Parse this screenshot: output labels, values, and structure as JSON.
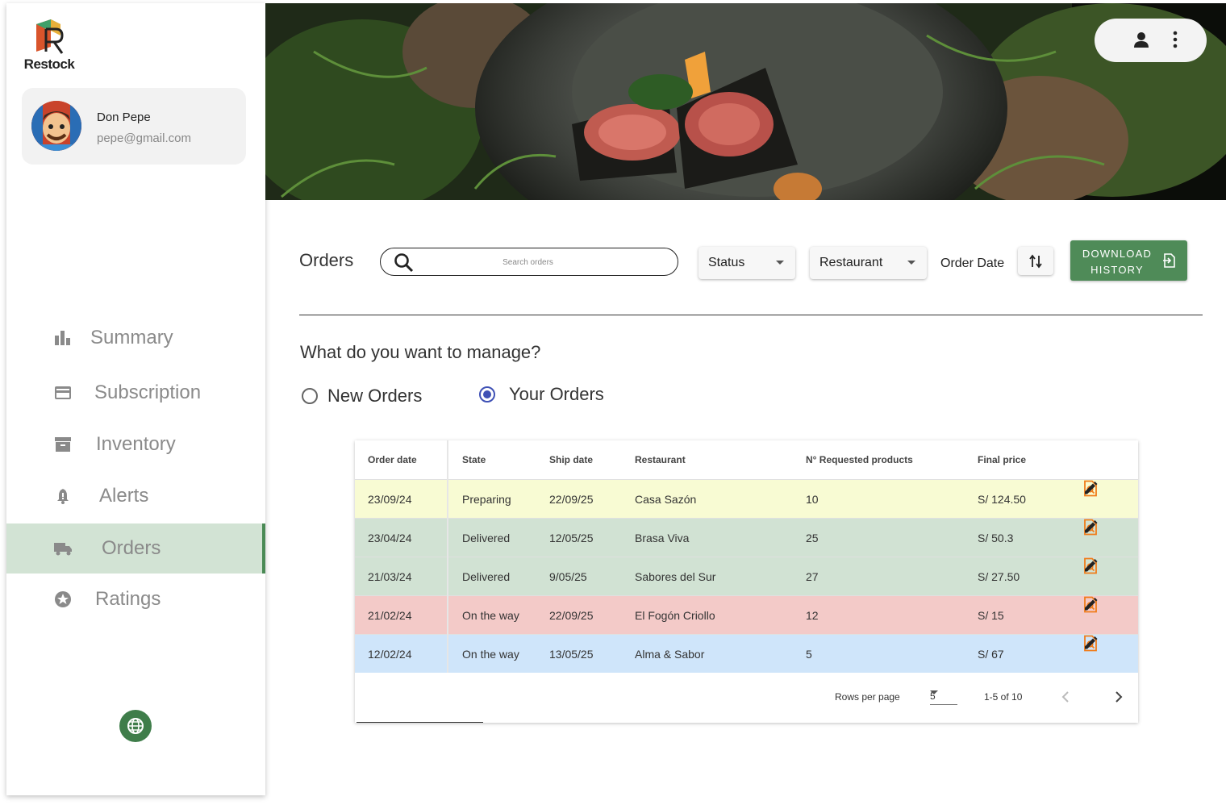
{
  "app": {
    "name": "Restock"
  },
  "profile": {
    "name": "Don Pepe",
    "email": "pepe@gmail.com"
  },
  "sidebar": {
    "items": [
      {
        "label": "Summary",
        "icon": "bar-chart-icon",
        "active": false
      },
      {
        "label": "Subscription",
        "icon": "credit-card-icon",
        "active": false
      },
      {
        "label": "Inventory",
        "icon": "archive-icon",
        "active": false
      },
      {
        "label": "Alerts",
        "icon": "bell-icon",
        "active": false
      },
      {
        "label": "Orders",
        "icon": "truck-icon",
        "active": true
      },
      {
        "label": "Ratings",
        "icon": "star-badge-icon",
        "active": false
      }
    ],
    "language_icon": "globe-icon"
  },
  "header": {
    "user_icon": "person-icon",
    "menu_icon": "more-vertical-icon"
  },
  "toolbar": {
    "title": "Orders",
    "search_placeholder": "Search orders",
    "status_label": "Status",
    "restaurant_label": "Restaurant",
    "order_date_label": "Order Date",
    "download_label": "DOWNLOAD HISTORY"
  },
  "manage": {
    "question": "What do you want to manage?",
    "options": [
      {
        "label": "New Orders",
        "selected": false
      },
      {
        "label": "Your Orders",
        "selected": true
      }
    ]
  },
  "table": {
    "columns": [
      "Order date",
      "State",
      "Ship date",
      "Restaurant",
      "N° Requested products",
      "Final price"
    ],
    "rows": [
      {
        "order_date": "23/09/24",
        "state": "Preparing",
        "ship_date": "22/09/25",
        "restaurant": "Casa Sazón",
        "products": "10",
        "price": "S/ 124.50",
        "color": "#f8fbd3"
      },
      {
        "order_date": "23/04/24",
        "state": "Delivered",
        "ship_date": "12/05/25",
        "restaurant": "Brasa Viva",
        "products": "25",
        "price": "S/ 50.3",
        "color": "#d1e2d3"
      },
      {
        "order_date": "21/03/24",
        "state": "Delivered",
        "ship_date": "9/05/25",
        "restaurant": "Sabores del Sur",
        "products": "27",
        "price": "S/ 27.50",
        "color": "#d1e2d3"
      },
      {
        "order_date": "21/02/24",
        "state": "On the way",
        "ship_date": "22/09/25",
        "restaurant": "El Fogón Criollo",
        "products": "12",
        "price": "S/ 15",
        "color": "#f3cac8"
      },
      {
        "order_date": "12/02/24",
        "state": "On the way",
        "ship_date": "13/05/25",
        "restaurant": "Alma & Sabor",
        "products": "5",
        "price": "S/ 67",
        "color": "#cfe5fa"
      }
    ],
    "pagination": {
      "rows_per_page_label": "Rows per page",
      "rows_per_page": "5",
      "range": "1-5 of 10"
    }
  },
  "colors": {
    "accent_green": "#4f8b58",
    "radio_blue": "#3f51b5",
    "view_icon_orange": "#f07c1a"
  }
}
